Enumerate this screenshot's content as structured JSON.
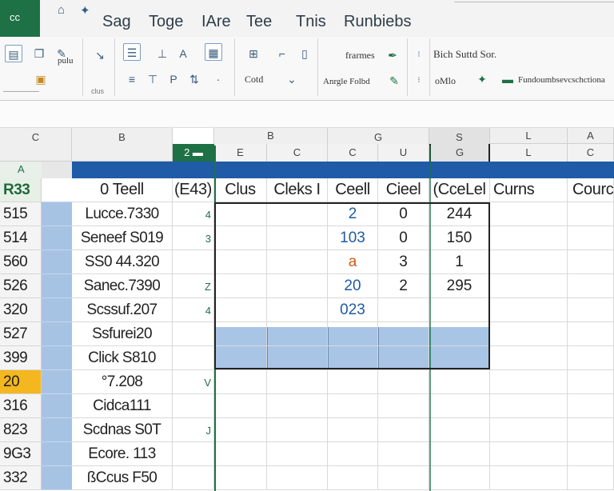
{
  "app": {
    "badge": "cc"
  },
  "tabs": [
    "Sag",
    "Toge",
    "IAre",
    "Tee",
    "Tnis",
    "Runbiebs"
  ],
  "ribbon": {
    "left_labels": [
      "pulu"
    ],
    "group_text": [
      "frarmes",
      "Anrgle Folbd",
      "Bich Suttd Sor.",
      "Fundoumbsevcschctiona"
    ],
    "items": [
      "Cotd",
      "oMlo"
    ],
    "group_label_1": "clus"
  },
  "columns_top": [
    "C",
    "B",
    "G",
    "S"
  ],
  "columns": [
    "A",
    "E",
    "C",
    "C",
    "U",
    "G",
    "L",
    "C",
    "A"
  ],
  "band_label": "A",
  "header_row": {
    "row": "R33",
    "name": "0 Teell",
    "c1": "(E43)",
    "c2": "Clus",
    "c3": "Cleks I",
    "c4": "Ceell",
    "c5": "Cieel",
    "c6": "(CceLel",
    "c7": "Curns",
    "c8": "Courc"
  },
  "rows": [
    {
      "row": "515",
      "name": "Lucce.7330",
      "mark": "4",
      "d": "2",
      "e": "0",
      "f": "244"
    },
    {
      "row": "514",
      "name": "Seneef S019",
      "mark": "3",
      "d": "103",
      "e": "0",
      "f": "150"
    },
    {
      "row": "560",
      "name": "SS0 44.320",
      "mark": "",
      "d": "a",
      "e": "3",
      "f": "1"
    },
    {
      "row": "526",
      "name": "Sanec.7390",
      "mark": "Z",
      "d": "20",
      "e": "2",
      "f": "295"
    },
    {
      "row": "320",
      "name": "Scssuf.207",
      "mark": "4",
      "d": "023",
      "e": "",
      "f": ""
    },
    {
      "row": "527",
      "name": "Ssfurei20",
      "mark": "",
      "d": "",
      "e": "",
      "f": ""
    },
    {
      "row": "399",
      "name": "Click S810",
      "mark": "",
      "d": "",
      "e": "",
      "f": ""
    },
    {
      "row": "20",
      "name": "°7.208",
      "mark": "V",
      "d": "",
      "e": "",
      "f": ""
    },
    {
      "row": "316",
      "name": "Cidca111",
      "mark": "",
      "d": "",
      "e": "",
      "f": ""
    },
    {
      "row": "823",
      "name": "Scdnas S0T",
      "mark": "J",
      "d": "",
      "e": "",
      "f": ""
    },
    {
      "row": "9G3",
      "name": "Ecore. 113",
      "mark": "",
      "d": "",
      "e": "",
      "f": ""
    },
    {
      "row": "332",
      "name": "ßCcus F50",
      "mark": "",
      "d": "",
      "e": "",
      "f": ""
    }
  ],
  "colors": {
    "excel_green": "#1e7145",
    "band_blue": "#1f5ba6",
    "cell_blue": "#a7c3e4",
    "selected_row": "#f4b71f"
  }
}
